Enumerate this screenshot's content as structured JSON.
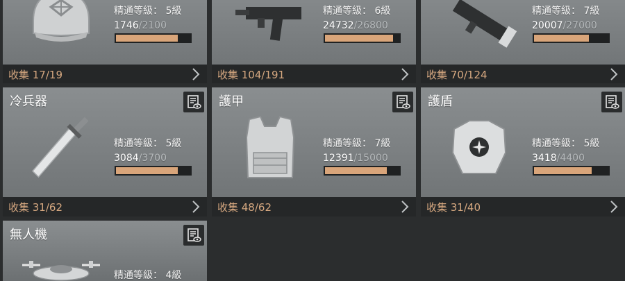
{
  "collect_prefix": "收集",
  "colors": {
    "accent": "#d9a57a",
    "panel": "#252728",
    "card": "#7e8284"
  },
  "cards": [
    {
      "id": "headgear",
      "title": "",
      "icon": "cap-icon",
      "level_label": "精通等級：",
      "level": "5級",
      "current": "1746",
      "max": "/2100",
      "progress": 0.83,
      "collect": "收集 17/19"
    },
    {
      "id": "gun",
      "title": "",
      "icon": "submachine-gun-icon",
      "level_label": "精通等級：",
      "level": "6級",
      "current": "24732",
      "max": "/26800",
      "progress": 0.92,
      "collect": "收集 104/191"
    },
    {
      "id": "launcher",
      "title": "",
      "icon": "rocket-launcher-icon",
      "level_label": "精通等級：",
      "level": "7級",
      "current": "20007",
      "max": "/27000",
      "progress": 0.74,
      "collect": "收集 70/124"
    },
    {
      "id": "melee",
      "title": "冷兵器",
      "icon": "sword-icon",
      "level_label": "精通等級：",
      "level": "5級",
      "current": "3084",
      "max": "/3700",
      "progress": 0.83,
      "collect": "收集 31/62"
    },
    {
      "id": "armor",
      "title": "護甲",
      "icon": "body-armor-icon",
      "level_label": "精通等級：",
      "level": "7級",
      "current": "12391",
      "max": "/15000",
      "progress": 0.83,
      "collect": "收集 48/62"
    },
    {
      "id": "shield",
      "title": "護盾",
      "icon": "shield-chest-icon",
      "level_label": "精通等級：",
      "level": "5級",
      "current": "3418",
      "max": "/4400",
      "progress": 0.78,
      "collect": "收集 31/40"
    },
    {
      "id": "drone",
      "title": "無人機",
      "icon": "drone-icon",
      "level_label": "精通等級：",
      "level": "4級",
      "current": "",
      "max": "",
      "progress": null,
      "collect": ""
    }
  ]
}
